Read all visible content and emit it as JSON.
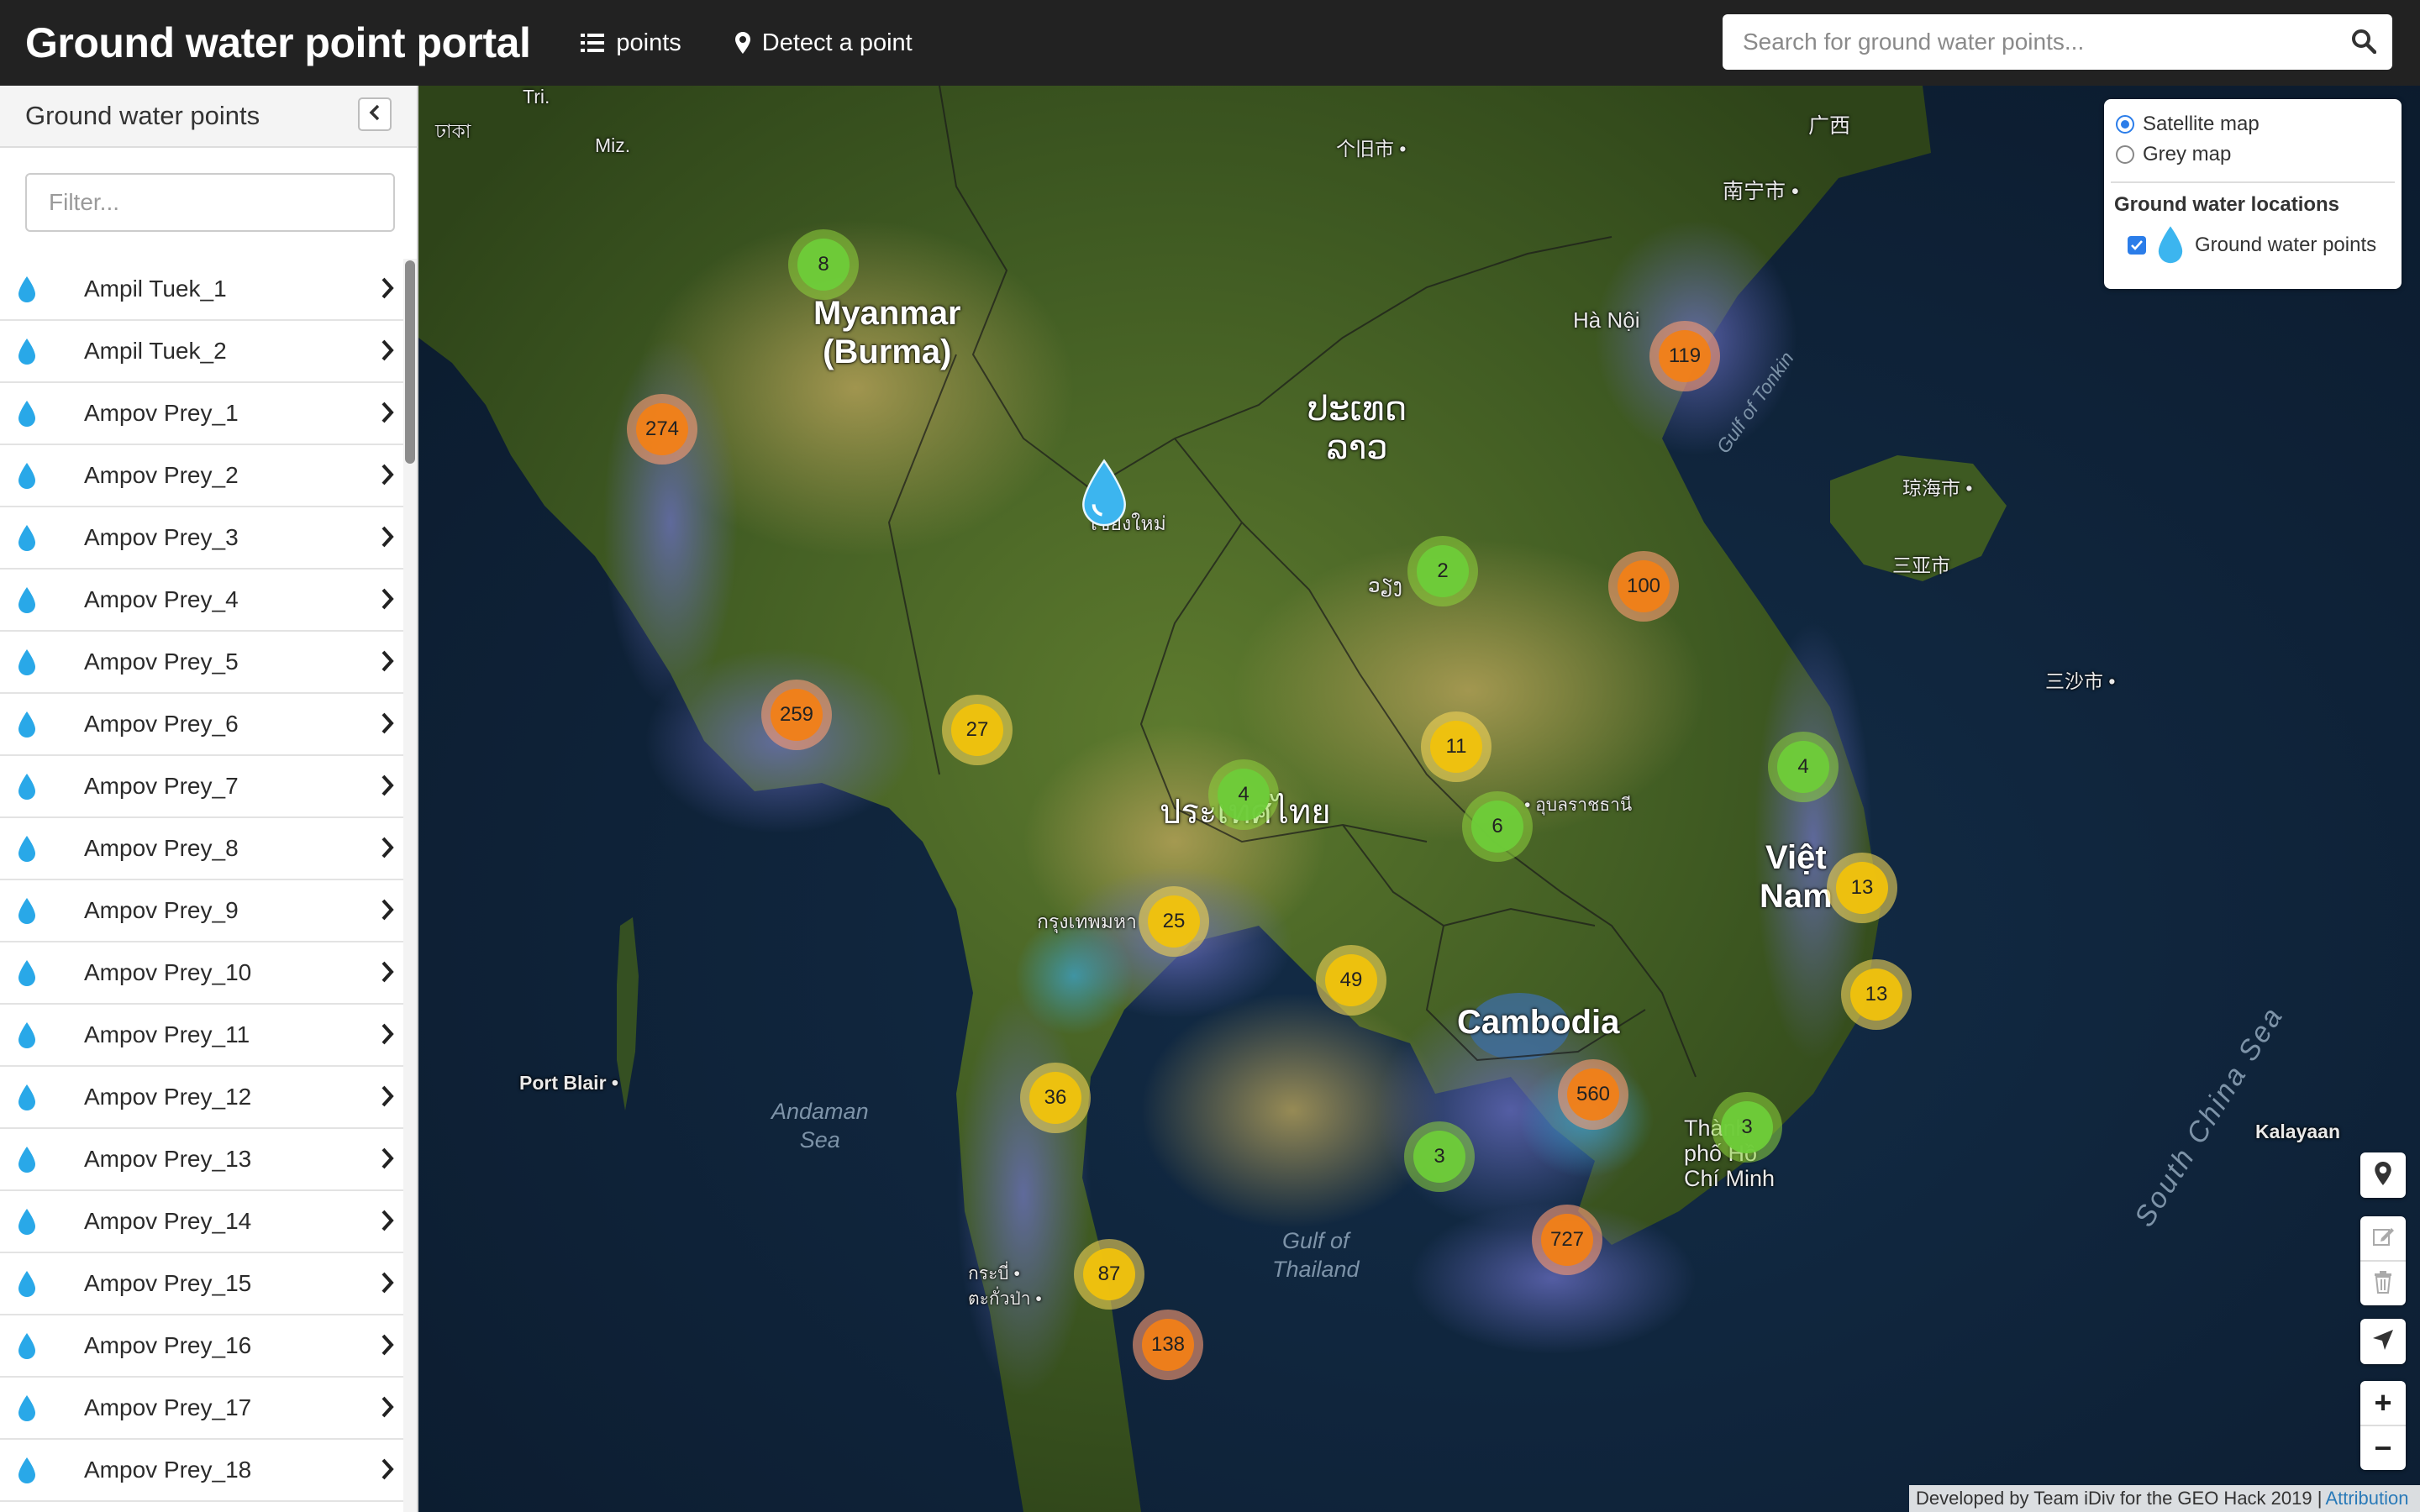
{
  "navbar": {
    "brand": "Ground water point portal",
    "links": [
      {
        "label": "points",
        "icon": "list-icon"
      },
      {
        "label": "Detect a point",
        "icon": "map-marker-icon"
      }
    ],
    "search": {
      "placeholder": "Search for ground water points..."
    }
  },
  "sidebar": {
    "title": "Ground water points",
    "filter_placeholder": "Filter...",
    "items": [
      {
        "label": "Ampil Tuek_1"
      },
      {
        "label": "Ampil Tuek_2"
      },
      {
        "label": "Ampov Prey_1"
      },
      {
        "label": "Ampov Prey_2"
      },
      {
        "label": "Ampov Prey_3"
      },
      {
        "label": "Ampov Prey_4"
      },
      {
        "label": "Ampov Prey_5"
      },
      {
        "label": "Ampov Prey_6"
      },
      {
        "label": "Ampov Prey_7"
      },
      {
        "label": "Ampov Prey_8"
      },
      {
        "label": "Ampov Prey_9"
      },
      {
        "label": "Ampov Prey_10"
      },
      {
        "label": "Ampov Prey_11"
      },
      {
        "label": "Ampov Prey_12"
      },
      {
        "label": "Ampov Prey_13"
      },
      {
        "label": "Ampov Prey_14"
      },
      {
        "label": "Ampov Prey_15"
      },
      {
        "label": "Ampov Prey_16"
      },
      {
        "label": "Ampov Prey_17"
      },
      {
        "label": "Ampov Prey_18"
      }
    ]
  },
  "map": {
    "countries": [
      {
        "text": "Myanmar\n(Burma)"
      },
      {
        "text": "ປະເທດ\nລາວ"
      },
      {
        "text": "ประเทศไทย"
      },
      {
        "text": "Cambodia"
      },
      {
        "text": "Việt\nNam"
      }
    ],
    "cities": [
      {
        "text": "Hà Nội"
      },
      {
        "text": "กรุงเทพมหา"
      },
      {
        "text": "Thành\nphố Hồ\nChí Minh"
      },
      {
        "text": "Port Blair •"
      },
      {
        "text": "Kalayaan"
      },
      {
        "text": "南宁市 •"
      },
      {
        "text": "广西"
      },
      {
        "text": "个旧市 •"
      },
      {
        "text": "琼海市 •"
      },
      {
        "text": "三亚市"
      },
      {
        "text": "三沙市 •"
      },
      {
        "text": "เชียงใหม่"
      },
      {
        "text": "ວຽງ"
      },
      {
        "text": "• อุบลราชธานี"
      },
      {
        "text": "กระบี่ •\nตะกั่วป่า •"
      },
      {
        "text": "Tri."
      },
      {
        "text": "Miz."
      },
      {
        "text": "ঢাকা"
      }
    ],
    "seas": [
      {
        "text": "Andaman\nSea"
      },
      {
        "text": "Gulf of\nThailand"
      },
      {
        "text": "Gulf of Tonkin"
      },
      {
        "text": "South China Sea"
      }
    ],
    "clusters": [
      {
        "count": "8",
        "size": "small"
      },
      {
        "count": "274",
        "size": "large"
      },
      {
        "count": "119",
        "size": "large"
      },
      {
        "count": "2",
        "size": "small"
      },
      {
        "count": "100",
        "size": "large"
      },
      {
        "count": "259",
        "size": "large"
      },
      {
        "count": "27",
        "size": "medium"
      },
      {
        "count": "11",
        "size": "medium"
      },
      {
        "count": "4",
        "size": "small"
      },
      {
        "count": "4",
        "size": "small"
      },
      {
        "count": "6",
        "size": "small"
      },
      {
        "count": "13",
        "size": "medium"
      },
      {
        "count": "25",
        "size": "medium"
      },
      {
        "count": "49",
        "size": "medium"
      },
      {
        "count": "13",
        "size": "medium"
      },
      {
        "count": "36",
        "size": "medium"
      },
      {
        "count": "560",
        "size": "large"
      },
      {
        "count": "3",
        "size": "small"
      },
      {
        "count": "3",
        "size": "small"
      },
      {
        "count": "727",
        "size": "large"
      },
      {
        "count": "87",
        "size": "medium"
      },
      {
        "count": "138",
        "size": "large"
      }
    ],
    "layer_control": {
      "base_layers": [
        {
          "label": "Satellite map",
          "selected": true
        },
        {
          "label": "Grey map",
          "selected": false
        }
      ],
      "overlay_title": "Ground water locations",
      "overlay_label": "Ground water points",
      "overlay_checked": true
    },
    "controls": {
      "zoom_in": "+",
      "zoom_out": "−"
    },
    "attribution": {
      "text": "Developed by Team iDiv for the GEO Hack 2019 |",
      "link": "Attribution"
    }
  },
  "colors": {
    "navbar_bg": "#222222",
    "drop_icon": "#29a8e8",
    "cluster_small": "#6ecc39",
    "cluster_medium": "#f0c20c",
    "cluster_large": "#f18017",
    "link": "#2a7ab8"
  }
}
